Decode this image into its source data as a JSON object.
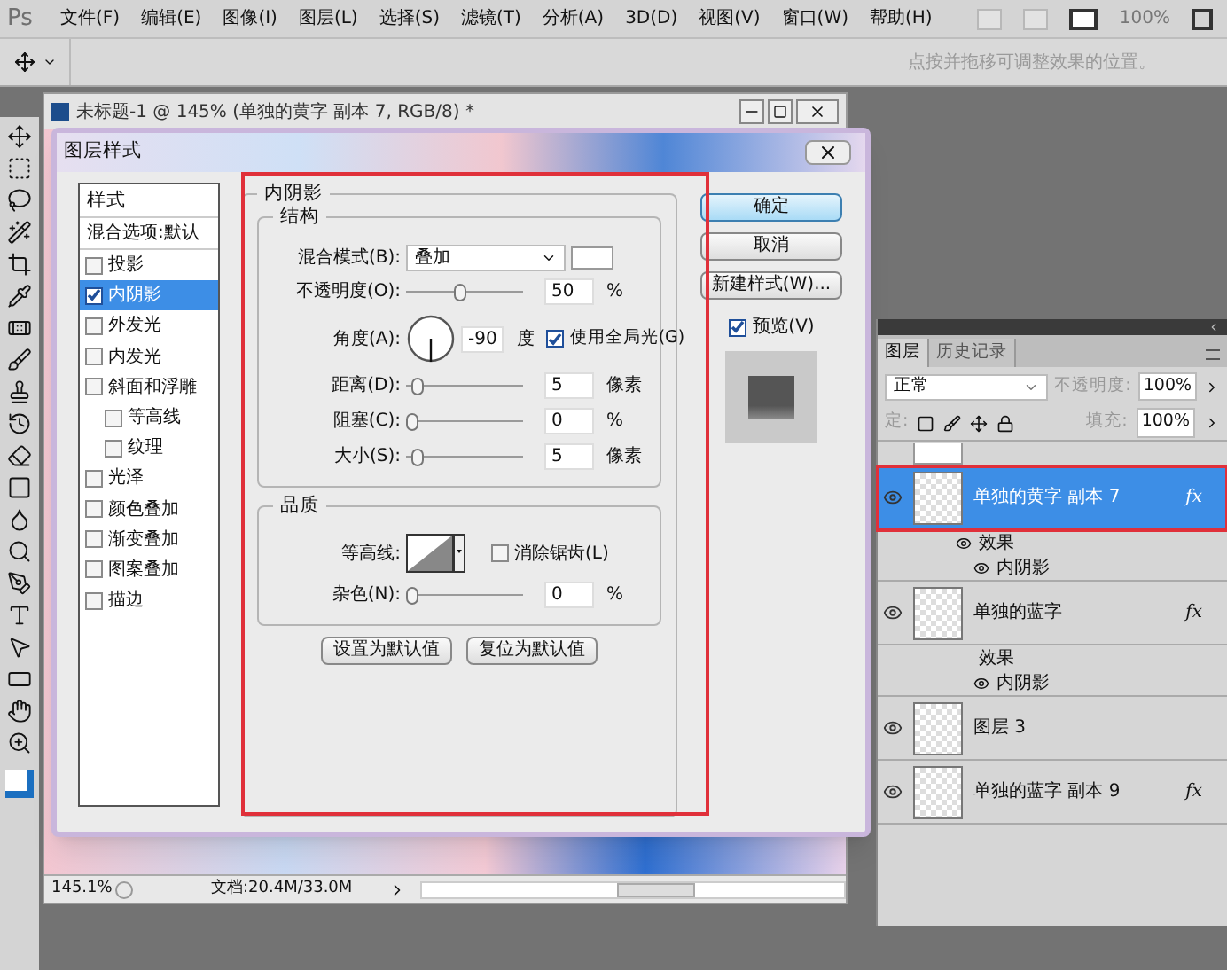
{
  "logo": "Ps",
  "menu": [
    "文件(F)",
    "编辑(E)",
    "图像(I)",
    "图层(L)",
    "选择(S)",
    "滤镜(T)",
    "分析(A)",
    "3D(D)",
    "视图(V)",
    "窗口(W)",
    "帮助(H)"
  ],
  "zoom": "100%",
  "options_hint": "点按并拖移可调整效果的位置。",
  "document": {
    "title": "未标题-1 @ 145% (单独的黄字 副本 7, RGB/8) *",
    "zoom": "145.1%",
    "doc_info": "文档:20.4M/33.0M"
  },
  "dialog": {
    "title": "图层样式",
    "styles_header": "样式",
    "styles": [
      {
        "label": "混合选项:默认",
        "kind": "header",
        "selected": false
      },
      {
        "label": "投影",
        "kind": "item",
        "checked": false,
        "selected": false
      },
      {
        "label": "内阴影",
        "kind": "item",
        "checked": true,
        "selected": true
      },
      {
        "label": "外发光",
        "kind": "item",
        "checked": false,
        "selected": false
      },
      {
        "label": "内发光",
        "kind": "item",
        "checked": false,
        "selected": false
      },
      {
        "label": "斜面和浮雕",
        "kind": "item",
        "checked": false,
        "selected": false
      },
      {
        "label": "等高线",
        "kind": "sub",
        "checked": false,
        "selected": false
      },
      {
        "label": "纹理",
        "kind": "sub",
        "checked": false,
        "selected": false
      },
      {
        "label": "光泽",
        "kind": "item",
        "checked": false,
        "selected": false
      },
      {
        "label": "颜色叠加",
        "kind": "item",
        "checked": false,
        "selected": false
      },
      {
        "label": "渐变叠加",
        "kind": "item",
        "checked": false,
        "selected": false
      },
      {
        "label": "图案叠加",
        "kind": "item",
        "checked": false,
        "selected": false
      },
      {
        "label": "描边",
        "kind": "item",
        "checked": false,
        "selected": false
      }
    ],
    "section": "内阴影",
    "structure": {
      "title": "结构",
      "fields": [
        {
          "kind": "select",
          "label": "混合模式(B):",
          "value": "叠加"
        },
        {
          "kind": "slider",
          "label": "不透明度(O):",
          "level": 0.45,
          "value": "50",
          "unit": "%"
        },
        {
          "kind": "angle",
          "label": "角度(A):",
          "value": "-90",
          "unit": "度",
          "check_label": "使用全局光(G)",
          "checked": true
        },
        {
          "kind": "slider",
          "label": "距离(D):",
          "level": 0.05,
          "value": "5",
          "unit": "像素"
        },
        {
          "kind": "slider",
          "label": "阻塞(C):",
          "level": 0,
          "value": "0",
          "unit": "%"
        },
        {
          "kind": "slider",
          "label": "大小(S):",
          "level": 0.05,
          "value": "5",
          "unit": "像素"
        }
      ]
    },
    "quality": {
      "title": "品质",
      "contour_label": "等高线:",
      "antialias": {
        "label": "消除锯齿(L)",
        "checked": false
      },
      "noise": {
        "label": "杂色(N):",
        "level": 0,
        "value": "0",
        "unit": "%"
      }
    },
    "bottom_buttons": [
      "设置为默认值",
      "复位为默认值"
    ],
    "buttons": [
      {
        "label": "确定",
        "default": true
      },
      {
        "label": "取消",
        "default": false
      },
      {
        "label": "新建样式(W)...",
        "default": false
      }
    ],
    "preview": {
      "label": "预览(V)",
      "checked": true
    }
  },
  "layers_panel": {
    "tabs": [
      {
        "label": "图层",
        "selected": true
      },
      {
        "label": "历史记录",
        "selected": false
      }
    ],
    "blend_mode": "正常",
    "opacity_label": "不透明度:",
    "opacity": "100%",
    "lock_label": "定:",
    "fill_label": "填充:",
    "fill": "100%",
    "layers": [
      {
        "kind": "layer",
        "name": "单独的黄字 副本 7",
        "selected": true,
        "fx": "fx"
      },
      {
        "kind": "effects",
        "name": "效果",
        "visible": true
      },
      {
        "kind": "effect",
        "name": "内阴影"
      },
      {
        "kind": "layer",
        "name": "单独的蓝字",
        "selected": false,
        "fx": "fx"
      },
      {
        "kind": "effects",
        "name": "效果",
        "visible": false
      },
      {
        "kind": "effect",
        "name": "内阴影"
      },
      {
        "kind": "layer",
        "name": "图层 3",
        "selected": false
      },
      {
        "kind": "layer",
        "name": "单独的蓝字 副本 9",
        "selected": false,
        "fx": "fx"
      }
    ]
  }
}
